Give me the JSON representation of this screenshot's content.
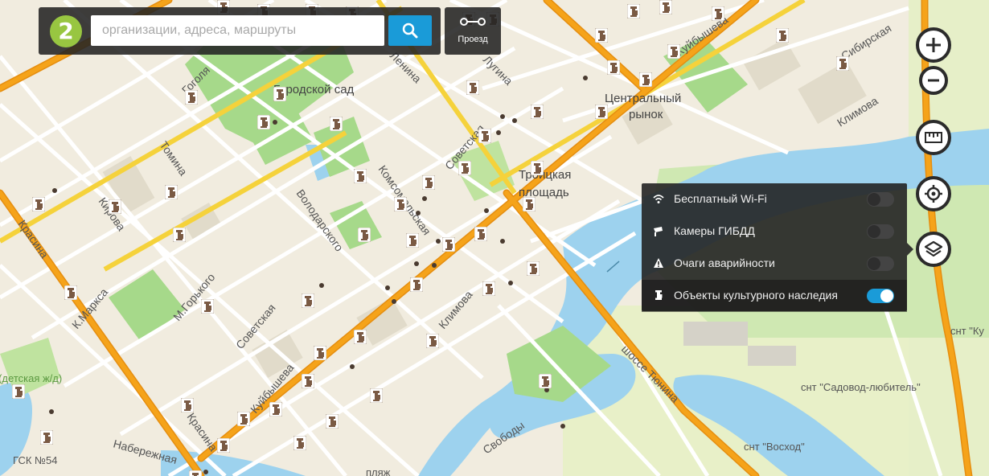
{
  "search": {
    "placeholder": "организации, адреса, маршруты",
    "value": ""
  },
  "logo": {
    "text": "2"
  },
  "route_button": {
    "label": "Проезд"
  },
  "zoom": {
    "in_label": "+",
    "out_label": "−"
  },
  "layers_panel": {
    "items": [
      {
        "label": "Бесплатный Wi-Fi",
        "icon": "wifi-icon",
        "enabled": false
      },
      {
        "label": "Камеры ГИБДД",
        "icon": "camera-icon",
        "enabled": false
      },
      {
        "label": "Очаги аварийности",
        "icon": "warning-icon",
        "enabled": false
      },
      {
        "label": "Объекты культурного наследия",
        "icon": "monument-icon",
        "enabled": true
      }
    ]
  },
  "map_labels": {
    "gogolya": "Гоголя",
    "gorodskoy_sad": "Городской сад",
    "lenina": "Ленина",
    "lugina": "Лугина",
    "kuybysheva_top": "Куйбышева",
    "sibirskaya": "Сибирская",
    "tsentralny_rynok_1": "Центральный",
    "tsentralny_rynok_2": "рынок",
    "klimova_top": "Климова",
    "tomina": "Томина",
    "kirova": "Кирова",
    "sovetskaya_top": "Советская",
    "komsomolskaya": "Комсомольская",
    "troitskaya_1": "Троицкая",
    "troitskaya_2": "площадь",
    "volodarskogo": "Володарского",
    "krasina_top": "Красина",
    "k_marksa": "К.Маркса",
    "m_gorkogo": "М.Горького",
    "sovetskaya_bottom": "Советская",
    "klimova_bottom": "Климова",
    "kuybysheva_bottom": "Куйбышева",
    "krasina_bottom": "Красина",
    "detskaya_zhd": "Парк (детская ж/д)",
    "naberezhnaya": "Набережная",
    "gsk": "ГСК №54",
    "plyazh": "пляж",
    "svobody": "Свободы",
    "shosse_tyunina": "шоссе Тюнина",
    "snt_sadovod": "снт \"Садовод-любитель\"",
    "snt_voskhod": "снт \"Восход\"",
    "snt_k": "снт \"Ку"
  },
  "colors": {
    "accent": "#1a9bd8",
    "logo": "#98c641",
    "panel": "#232323",
    "major_road": "#f5a31a",
    "secondary_road": "#f5d23b",
    "water": "#9dd2ee",
    "park": "#a6d98a",
    "monument": "#7a5a44"
  }
}
